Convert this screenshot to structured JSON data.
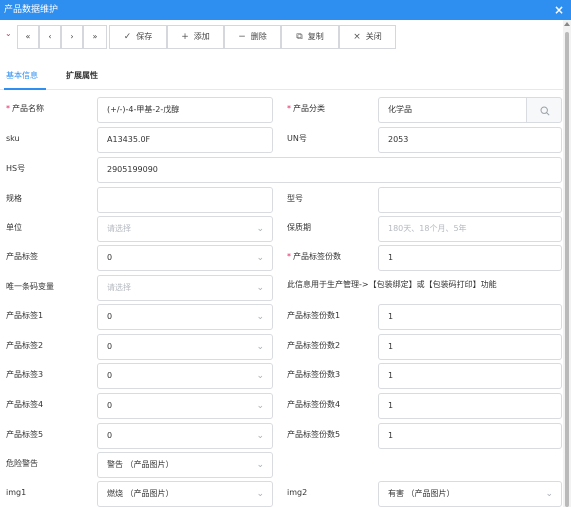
{
  "window": {
    "title": "产品数据维护",
    "close_icon": "×"
  },
  "toolbar": {
    "first": "«",
    "prev": "‹",
    "next": "›",
    "last": "»",
    "save_icon": "✓",
    "save": "保存",
    "add_icon": "+",
    "add": "添加",
    "delete_icon": "−",
    "delete": "删除",
    "copy_icon": "⧉",
    "copy": "复制",
    "close_icon": "×",
    "close": "关闭"
  },
  "tabs": [
    "基本信息",
    "扩展属性"
  ],
  "form": {
    "product_name": {
      "label": "产品名称",
      "required_mark": "*",
      "value": "(+/-)-4-甲基-2-戊醇"
    },
    "product_category": {
      "label": "产品分类",
      "required_mark": "*",
      "value": "化学品"
    },
    "sku": {
      "label": "sku",
      "value": "A13435.0F"
    },
    "un_no": {
      "label": "UN号",
      "value": "2053"
    },
    "hs_no": {
      "label": "HS号",
      "value": "2905199090"
    },
    "spec": {
      "label": "规格",
      "value": ""
    },
    "model": {
      "label": "型号",
      "value": ""
    },
    "unit": {
      "label": "单位",
      "placeholder": "请选择"
    },
    "shelf_life": {
      "label": "保质期",
      "placeholder": "180天、18个月、5年"
    },
    "product_label": {
      "label": "产品标签",
      "value": "0"
    },
    "label_copies": {
      "label": "产品标签份数",
      "required_mark": "*",
      "value": "1"
    },
    "barcode_variable": {
      "label": "唯一条码变量",
      "placeholder": "请选择"
    },
    "barcode_note": "此信息用于生产管理->【包装绑定】或【包装码打印】功能",
    "label_1": {
      "label": "产品标签1",
      "value": "0"
    },
    "copies_1": {
      "label": "产品标签份数1",
      "value": "1"
    },
    "label_2": {
      "label": "产品标签2",
      "value": "0"
    },
    "copies_2": {
      "label": "产品标签份数2",
      "value": "1"
    },
    "label_3": {
      "label": "产品标签3",
      "value": "0"
    },
    "copies_3": {
      "label": "产品标签份数3",
      "value": "1"
    },
    "label_4": {
      "label": "产品标签4",
      "value": "0"
    },
    "copies_4": {
      "label": "产品标签份数4",
      "value": "1"
    },
    "label_5": {
      "label": "产品标签5",
      "value": "0"
    },
    "copies_5": {
      "label": "产品标签份数5",
      "value": "1"
    },
    "hazard_warning": {
      "label": "危险警告",
      "value": "警告 （产品图片）"
    },
    "img1": {
      "label": "img1",
      "value": "燃烧 （产品图片）"
    },
    "img2": {
      "label": "img2",
      "value": "有害 （产品图片）"
    }
  },
  "icons": {
    "chevron": "chevron-down-icon",
    "search": "search-icon",
    "collapse": "collapse-arrow-icon"
  },
  "colors": {
    "accent": "#2f8ff0",
    "required": "#e0245e"
  }
}
